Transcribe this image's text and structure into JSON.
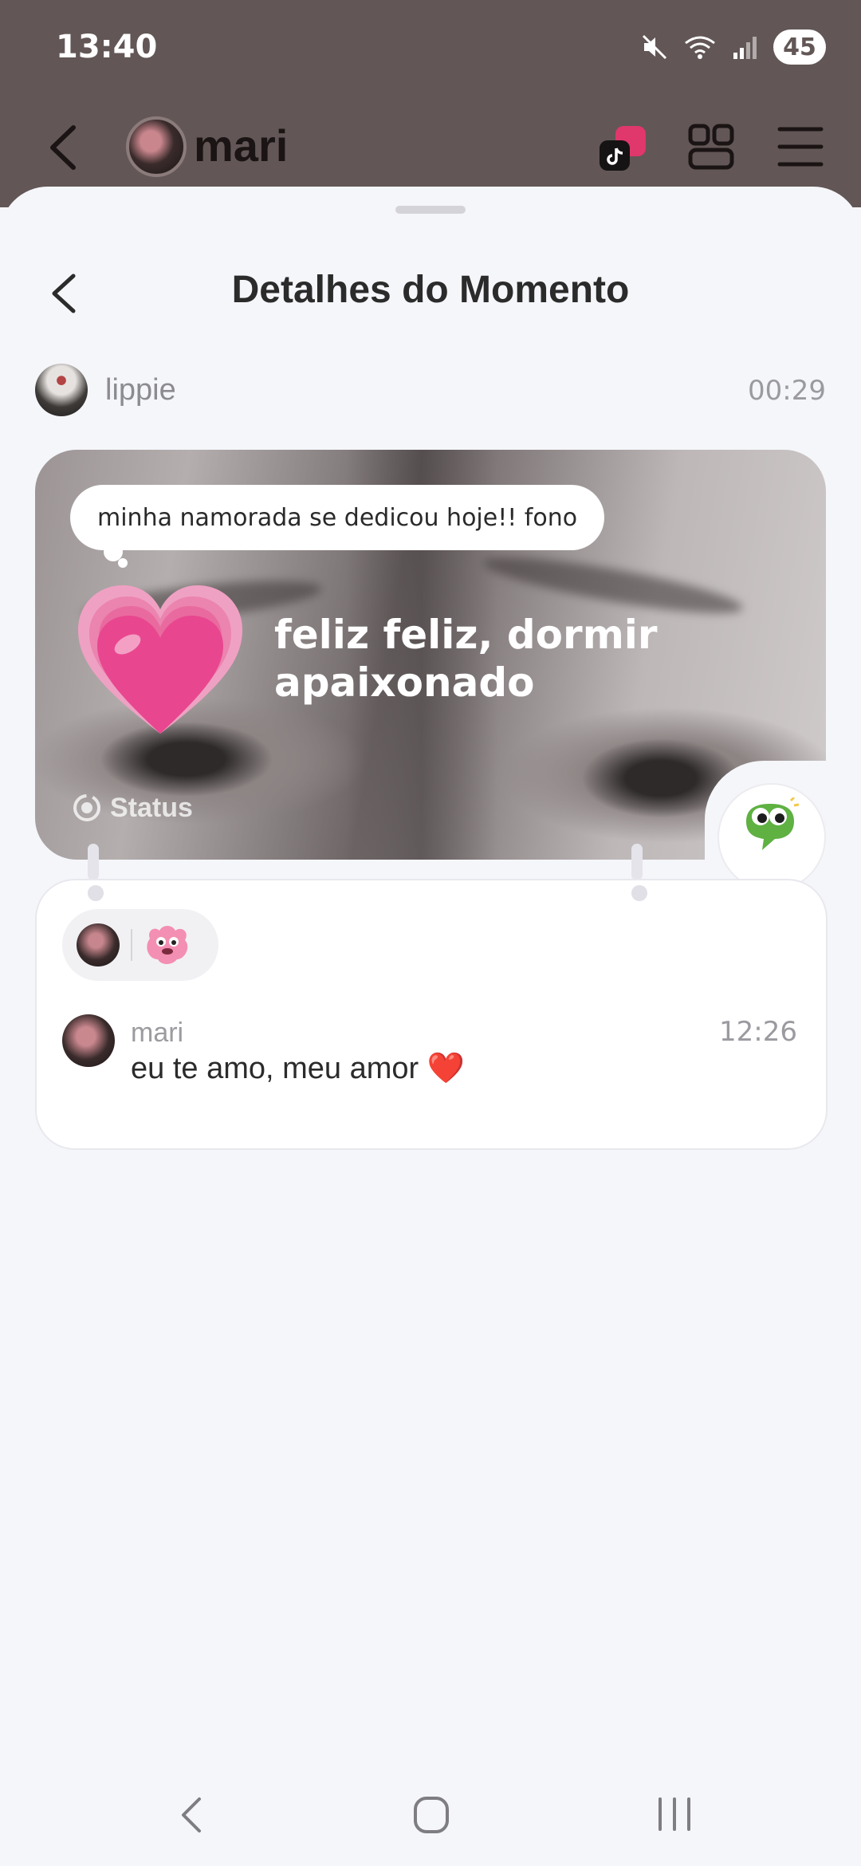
{
  "status_bar": {
    "time": "13:40",
    "battery": "45"
  },
  "header": {
    "contact_name": "mari"
  },
  "sheet": {
    "title": "Detalhes do Momento"
  },
  "moment": {
    "author": "lippie",
    "time": "00:29",
    "caption": "minha namorada se dedicou hoje!! fono",
    "status_text": "feliz feliz, dormir apaixonado",
    "status_label": "Status"
  },
  "comment": {
    "author": "mari",
    "time": "12:26",
    "text": "eu te amo, meu amor ❤️"
  },
  "colors": {
    "backdrop": "#625756",
    "sheet": "#F5F6FA",
    "heart": "#E8478F",
    "frog": "#5FB142"
  }
}
